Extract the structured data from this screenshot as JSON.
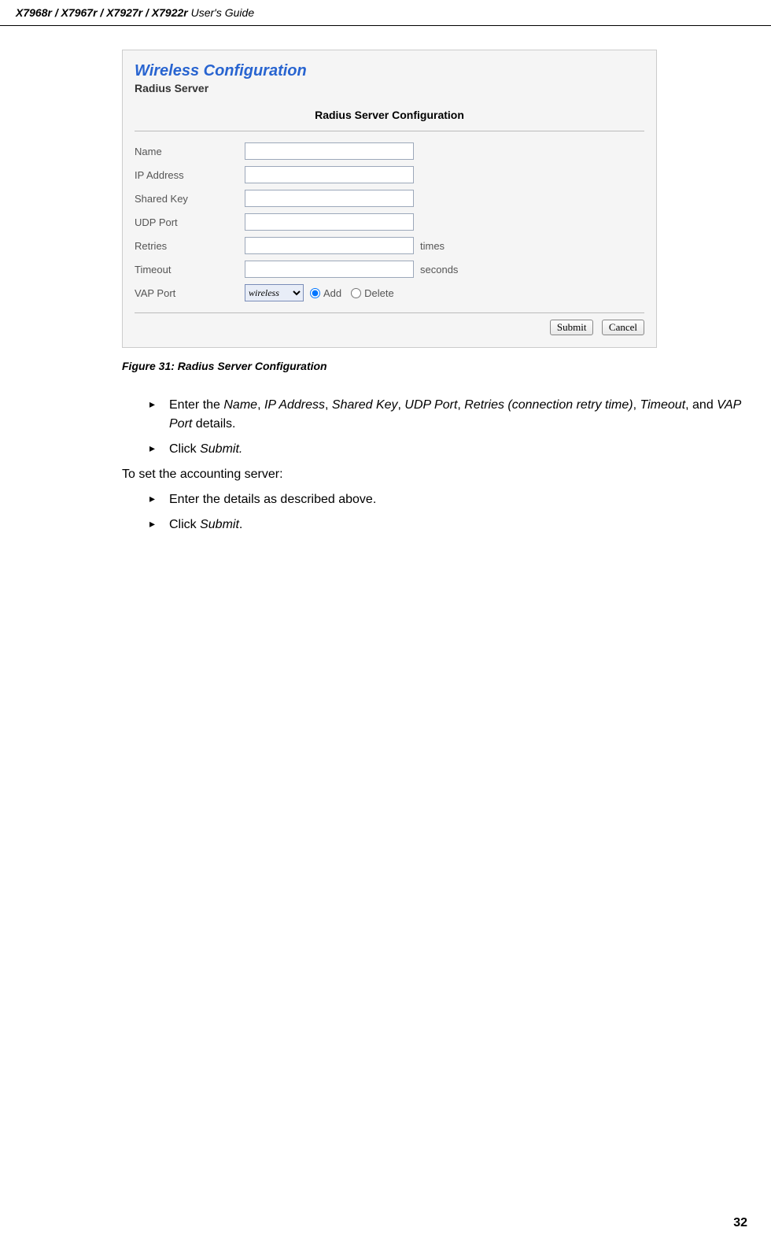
{
  "header": {
    "bold": "X7968r / X7967r / X7927r / X7922r",
    "rest": " User's Guide"
  },
  "screenshot": {
    "title": "Wireless Configuration",
    "subtitle": "Radius Server",
    "section_header": "Radius Server Configuration",
    "fields": {
      "name": "Name",
      "ip": "IP Address",
      "shared_key": "Shared Key",
      "udp": "UDP Port",
      "retries": "Retries",
      "retries_suffix": "times",
      "timeout": "Timeout",
      "timeout_suffix": "seconds",
      "vap": "VAP Port",
      "vap_value": "wireless",
      "add": "Add",
      "delete": "Delete"
    },
    "buttons": {
      "submit": "Submit",
      "cancel": "Cancel"
    }
  },
  "figure_caption": "Figure 31: Radius Server Configuration",
  "instructions": {
    "item1_pre": "Enter the ",
    "item1_name": "Name",
    "item1_ip": "IP Address",
    "item1_sk": "Shared Key",
    "item1_udp": "UDP Port",
    "item1_retries": "Retries (connection retry time)",
    "item1_timeout": "Timeout",
    "item1_and": ", and ",
    "item1_vap": "VAP Port",
    "item1_end": " details.",
    "item2_pre": "Click ",
    "item2_btn": "Submit.",
    "text3": "To set the accounting server:",
    "item4": "Enter the details as described above.",
    "item5_pre": "Click ",
    "item5_btn": "Submit",
    "item5_end": "."
  },
  "page_number": "32"
}
